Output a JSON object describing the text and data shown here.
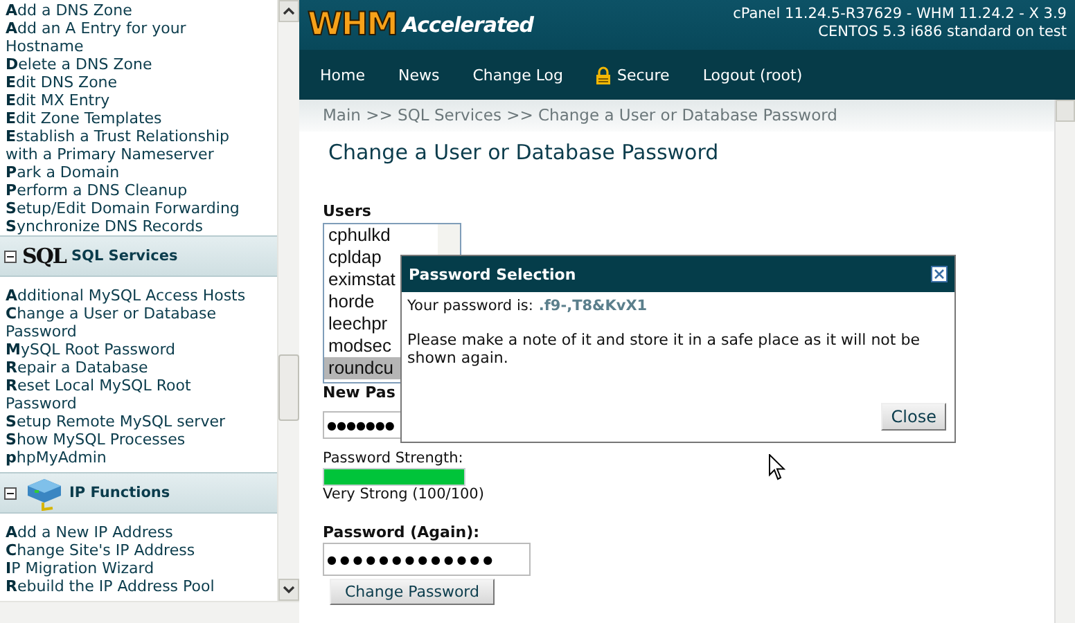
{
  "sidebar": {
    "sections": [
      {
        "kind": "plain",
        "links": [
          "**A**dd a DNS Zone",
          "**A**dd an A Entry for your Hostname",
          "**D**elete a DNS Zone",
          "**E**dit DNS Zone",
          "**E**dit MX Entry",
          "**E**dit Zone Templates",
          "**E**stablish a Trust Relationship with a Primary Nameserver",
          "**P**ark a Domain",
          "**P**erform a DNS Cleanup",
          "**S**etup/Edit Domain Forwarding",
          "**S**ynchronize DNS Records"
        ]
      },
      {
        "kind": "sql",
        "logo": "SQL",
        "title": "SQL Services",
        "expanded": true,
        "links": [
          "**A**dditional MySQL Access Hosts",
          "**C**hange a User or Database Password",
          "**M**ySQL Root Password",
          "**R**epair a Database",
          "**R**eset Local MySQL Root Password",
          "**S**etup Remote MySQL server",
          "**S**how MySQL Processes",
          "**p**hpMyAdmin"
        ]
      },
      {
        "kind": "ip",
        "title": "IP Functions",
        "expanded": true,
        "links": [
          "**A**dd a New IP Address",
          "**C**hange Site's IP Address",
          "**I**P Migration Wizard",
          "**R**ebuild the IP Address Pool"
        ]
      }
    ]
  },
  "header": {
    "logo_main": "WHM",
    "logo_sub": "Accelerated",
    "version_lines": [
      "cPanel 11.24.5-R37629 - WHM 11.24.2 - X 3.9",
      "CENTOS 5.3 i686 standard on test"
    ]
  },
  "nav": [
    {
      "label": "Home",
      "kind": "plain"
    },
    {
      "label": "News",
      "kind": "plain"
    },
    {
      "label": "Change Log",
      "kind": "plain"
    },
    {
      "label": "Secure",
      "kind": "lock"
    },
    {
      "label": "Logout (root)",
      "kind": "plain"
    }
  ],
  "breadcrumb": "Main >> SQL Services >> Change a User or Database Password",
  "page_title": "Change a User or Database Password",
  "form": {
    "users_label": "Users",
    "users": [
      {
        "label": "cphulkd",
        "selected": false
      },
      {
        "label": "cpldap",
        "selected": false
      },
      {
        "label": "eximstat",
        "selected": false
      },
      {
        "label": "horde",
        "selected": false
      },
      {
        "label": "leechpr",
        "selected": false
      },
      {
        "label": "modsec",
        "selected": false
      },
      {
        "label": "roundcu",
        "selected": true
      }
    ],
    "new_password_label": "New Pas",
    "new_password_value": "●●●●●●●",
    "strength_label": "Password Strength:",
    "strength": {
      "level": 1.0,
      "reading": "Very Strong (100/100)"
    },
    "again_label": "Password (Again):",
    "again_value": "●●●●●●●●●●●●●",
    "submit": "Change Password"
  },
  "dialog": {
    "title": "Password Selection",
    "password_label": "Your password is:",
    "password": ".f9-,T8&KvX1",
    "note": "Please make a note of it and store it in a safe place as it will not be shown again.",
    "close": "Close"
  }
}
